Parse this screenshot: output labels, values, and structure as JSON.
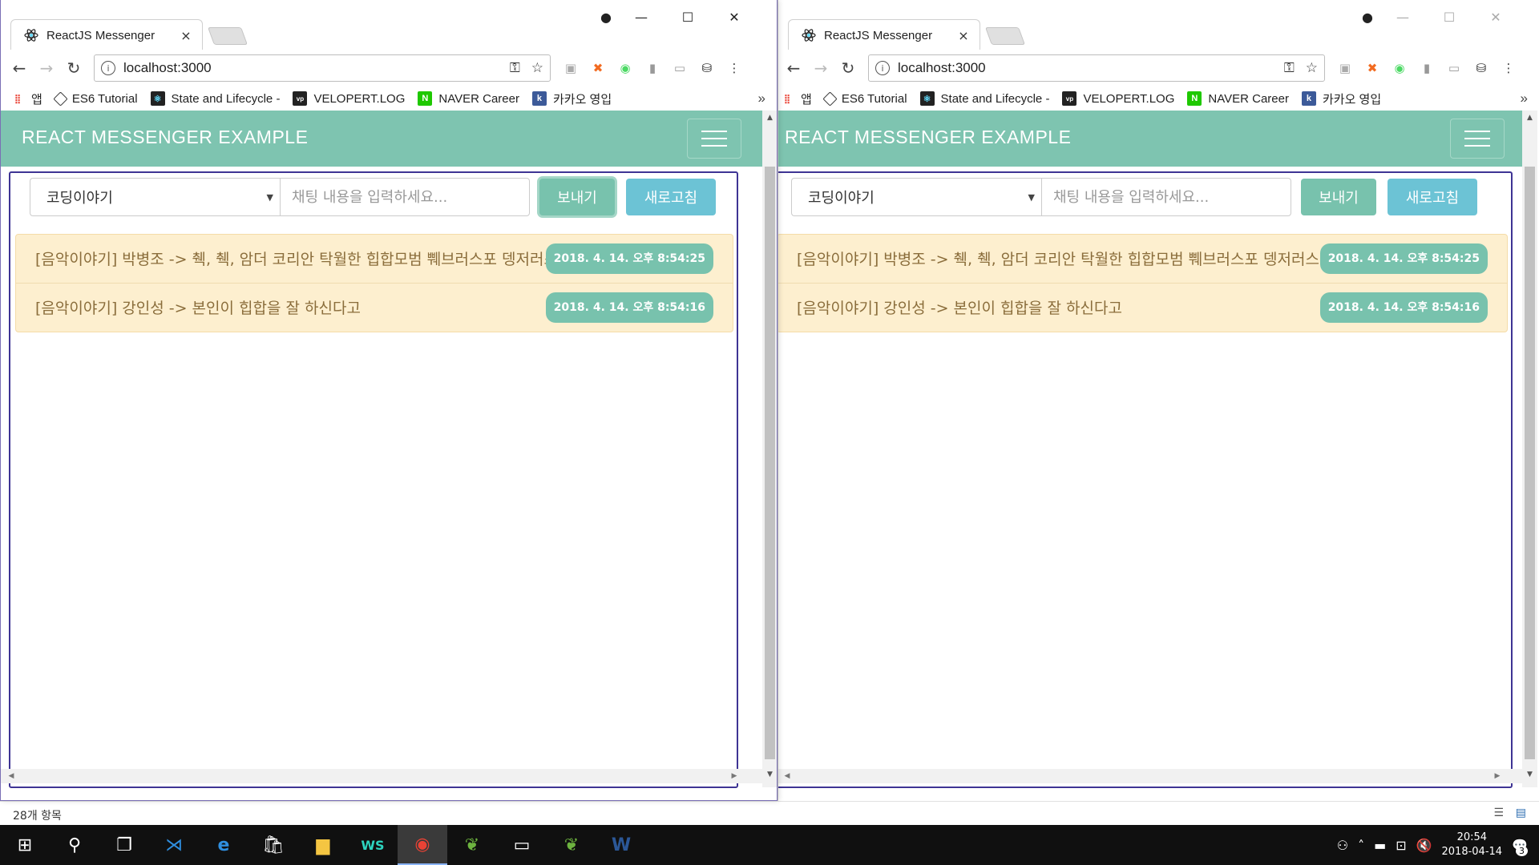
{
  "browser": {
    "tab_title": "ReactJS Messenger",
    "url": "localhost:3000",
    "bookmarks": [
      {
        "label": "앱",
        "icon": "apps-grid-icon"
      },
      {
        "label": "ES6 Tutorial",
        "icon": "es6-icon"
      },
      {
        "label": "State and Lifecycle -",
        "icon": "react-icon"
      },
      {
        "label": "VELOPERT.LOG",
        "icon": "velopert-icon"
      },
      {
        "label": "NAVER Career",
        "icon": "naver-icon"
      },
      {
        "label": "카카오 영입",
        "icon": "kakao-icon"
      }
    ],
    "more_label": "»"
  },
  "app": {
    "brand": "REACT MESSENGER EXAMPLE",
    "room_select": "코딩이야기",
    "input_placeholder": "채팅 내용을 입력하세요...",
    "send_label": "보내기",
    "refresh_label": "새로고침",
    "messages": [
      {
        "text": "[음악이야기] 박병조 -> 췍, 췍, 암더 코리안 탁월한 힙합모범 쀄브러스포 뎅저러스",
        "time": "2018. 4. 14. 오후 8:54:25"
      },
      {
        "text": "[음악이야기] 강인성 -> 본인이 힙합을 잘 하신다고",
        "time": "2018. 4. 14. 오후 8:54:16"
      }
    ]
  },
  "explorer": {
    "status": "28개 항목"
  },
  "taskbar": {
    "time": "20:54",
    "date": "2018-04-14",
    "notifications": "3"
  },
  "colors": {
    "navbar": "#7ec4b0",
    "send": "#78c2ad",
    "refresh": "#6cc3d5",
    "message_bg": "#fdefcf",
    "message_text": "#8a6d3b",
    "panel_border": "#3e3494"
  }
}
